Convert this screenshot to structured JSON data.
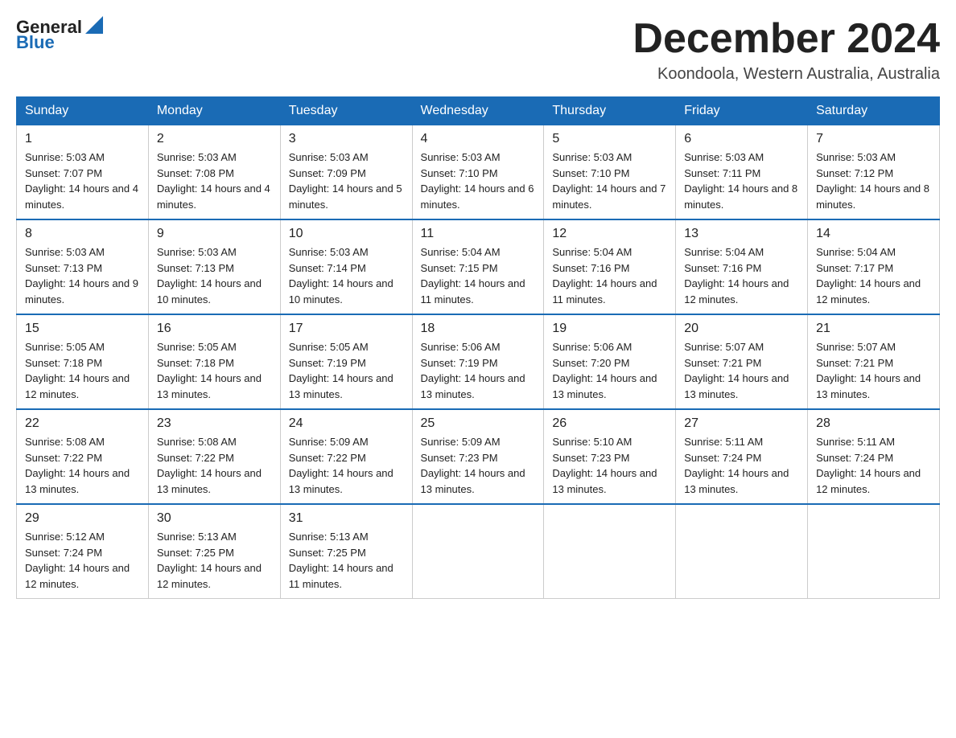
{
  "header": {
    "logo": {
      "text_general": "General",
      "text_blue": "Blue"
    },
    "title": "December 2024",
    "location": "Koondoola, Western Australia, Australia"
  },
  "calendar": {
    "days_of_week": [
      "Sunday",
      "Monday",
      "Tuesday",
      "Wednesday",
      "Thursday",
      "Friday",
      "Saturday"
    ],
    "weeks": [
      [
        {
          "day": "1",
          "sunrise": "5:03 AM",
          "sunset": "7:07 PM",
          "daylight": "14 hours and 4 minutes."
        },
        {
          "day": "2",
          "sunrise": "5:03 AM",
          "sunset": "7:08 PM",
          "daylight": "14 hours and 4 minutes."
        },
        {
          "day": "3",
          "sunrise": "5:03 AM",
          "sunset": "7:09 PM",
          "daylight": "14 hours and 5 minutes."
        },
        {
          "day": "4",
          "sunrise": "5:03 AM",
          "sunset": "7:10 PM",
          "daylight": "14 hours and 6 minutes."
        },
        {
          "day": "5",
          "sunrise": "5:03 AM",
          "sunset": "7:10 PM",
          "daylight": "14 hours and 7 minutes."
        },
        {
          "day": "6",
          "sunrise": "5:03 AM",
          "sunset": "7:11 PM",
          "daylight": "14 hours and 8 minutes."
        },
        {
          "day": "7",
          "sunrise": "5:03 AM",
          "sunset": "7:12 PM",
          "daylight": "14 hours and 8 minutes."
        }
      ],
      [
        {
          "day": "8",
          "sunrise": "5:03 AM",
          "sunset": "7:13 PM",
          "daylight": "14 hours and 9 minutes."
        },
        {
          "day": "9",
          "sunrise": "5:03 AM",
          "sunset": "7:13 PM",
          "daylight": "14 hours and 10 minutes."
        },
        {
          "day": "10",
          "sunrise": "5:03 AM",
          "sunset": "7:14 PM",
          "daylight": "14 hours and 10 minutes."
        },
        {
          "day": "11",
          "sunrise": "5:04 AM",
          "sunset": "7:15 PM",
          "daylight": "14 hours and 11 minutes."
        },
        {
          "day": "12",
          "sunrise": "5:04 AM",
          "sunset": "7:16 PM",
          "daylight": "14 hours and 11 minutes."
        },
        {
          "day": "13",
          "sunrise": "5:04 AM",
          "sunset": "7:16 PM",
          "daylight": "14 hours and 12 minutes."
        },
        {
          "day": "14",
          "sunrise": "5:04 AM",
          "sunset": "7:17 PM",
          "daylight": "14 hours and 12 minutes."
        }
      ],
      [
        {
          "day": "15",
          "sunrise": "5:05 AM",
          "sunset": "7:18 PM",
          "daylight": "14 hours and 12 minutes."
        },
        {
          "day": "16",
          "sunrise": "5:05 AM",
          "sunset": "7:18 PM",
          "daylight": "14 hours and 13 minutes."
        },
        {
          "day": "17",
          "sunrise": "5:05 AM",
          "sunset": "7:19 PM",
          "daylight": "14 hours and 13 minutes."
        },
        {
          "day": "18",
          "sunrise": "5:06 AM",
          "sunset": "7:19 PM",
          "daylight": "14 hours and 13 minutes."
        },
        {
          "day": "19",
          "sunrise": "5:06 AM",
          "sunset": "7:20 PM",
          "daylight": "14 hours and 13 minutes."
        },
        {
          "day": "20",
          "sunrise": "5:07 AM",
          "sunset": "7:21 PM",
          "daylight": "14 hours and 13 minutes."
        },
        {
          "day": "21",
          "sunrise": "5:07 AM",
          "sunset": "7:21 PM",
          "daylight": "14 hours and 13 minutes."
        }
      ],
      [
        {
          "day": "22",
          "sunrise": "5:08 AM",
          "sunset": "7:22 PM",
          "daylight": "14 hours and 13 minutes."
        },
        {
          "day": "23",
          "sunrise": "5:08 AM",
          "sunset": "7:22 PM",
          "daylight": "14 hours and 13 minutes."
        },
        {
          "day": "24",
          "sunrise": "5:09 AM",
          "sunset": "7:22 PM",
          "daylight": "14 hours and 13 minutes."
        },
        {
          "day": "25",
          "sunrise": "5:09 AM",
          "sunset": "7:23 PM",
          "daylight": "14 hours and 13 minutes."
        },
        {
          "day": "26",
          "sunrise": "5:10 AM",
          "sunset": "7:23 PM",
          "daylight": "14 hours and 13 minutes."
        },
        {
          "day": "27",
          "sunrise": "5:11 AM",
          "sunset": "7:24 PM",
          "daylight": "14 hours and 13 minutes."
        },
        {
          "day": "28",
          "sunrise": "5:11 AM",
          "sunset": "7:24 PM",
          "daylight": "14 hours and 12 minutes."
        }
      ],
      [
        {
          "day": "29",
          "sunrise": "5:12 AM",
          "sunset": "7:24 PM",
          "daylight": "14 hours and 12 minutes."
        },
        {
          "day": "30",
          "sunrise": "5:13 AM",
          "sunset": "7:25 PM",
          "daylight": "14 hours and 12 minutes."
        },
        {
          "day": "31",
          "sunrise": "5:13 AM",
          "sunset": "7:25 PM",
          "daylight": "14 hours and 11 minutes."
        },
        null,
        null,
        null,
        null
      ]
    ]
  }
}
